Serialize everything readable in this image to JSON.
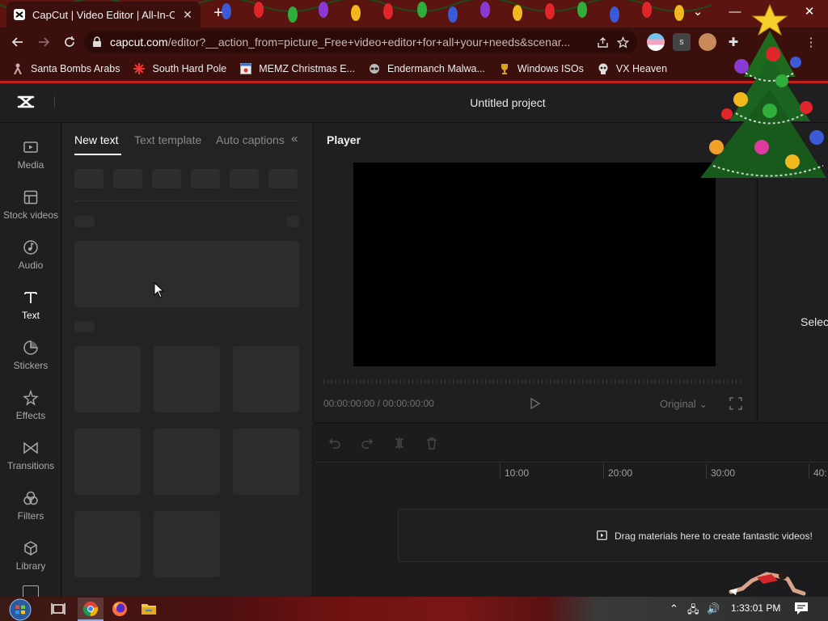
{
  "browser": {
    "tab_title": "CapCut | Video Editor | All-In-One",
    "url_host": "capcut.com",
    "url_rest": "/editor?__action_from=picture_Free+video+editor+for+all+your+needs&scenar...",
    "window_controls": {
      "minimize": "—",
      "close": "✕",
      "dropdown": "⌄"
    },
    "new_tab": "+",
    "profile_badge": "s"
  },
  "bookmarks": [
    {
      "label": "Santa Bombs Arabs",
      "icon": "figure-icon"
    },
    {
      "label": "South Hard Pole",
      "icon": "snowflake-icon"
    },
    {
      "label": "MEMZ Christmas E...",
      "icon": "window-icon"
    },
    {
      "label": "Endermanch Malwa...",
      "icon": "raccoon-icon"
    },
    {
      "label": "Windows ISOs",
      "icon": "trophy-icon"
    },
    {
      "label": "VX Heaven",
      "icon": "skull-icon"
    }
  ],
  "editor": {
    "project_title": "Untitled project"
  },
  "sidebar": {
    "items": [
      {
        "label": "Media",
        "icon": "media-icon"
      },
      {
        "label": "Stock videos",
        "icon": "stock-videos-icon"
      },
      {
        "label": "Audio",
        "icon": "audio-icon"
      },
      {
        "label": "Text",
        "icon": "text-icon",
        "active": true
      },
      {
        "label": "Stickers",
        "icon": "stickers-icon"
      },
      {
        "label": "Effects",
        "icon": "effects-icon"
      },
      {
        "label": "Transitions",
        "icon": "transitions-icon"
      },
      {
        "label": "Filters",
        "icon": "filters-icon"
      },
      {
        "label": "Library",
        "icon": "library-icon"
      }
    ]
  },
  "text_panel": {
    "tabs": [
      "New text",
      "Text template",
      "Auto captions"
    ],
    "active_tab": "New text",
    "collapse_icon": "«"
  },
  "player": {
    "label": "Player",
    "timecode": "00:00:00:00 / 00:00:00:00",
    "ratio": "Original ⌄"
  },
  "right_panel": {
    "label": "Selec"
  },
  "timeline": {
    "ruler": [
      "10:00",
      "20:00",
      "30:00",
      "40:"
    ],
    "drop_hint": "Drag materials here to create fantastic videos!"
  },
  "taskbar": {
    "clock": "1:33:01 PM",
    "tray": {
      "chevron": "⌃",
      "network": "🖧",
      "volume": "🔊"
    }
  },
  "colors": {
    "chrome_frame": "#3a0f0c",
    "bookmark_border": "#c21f1f",
    "editor_bg": "#1f1f21",
    "panel_bg": "#232325"
  }
}
